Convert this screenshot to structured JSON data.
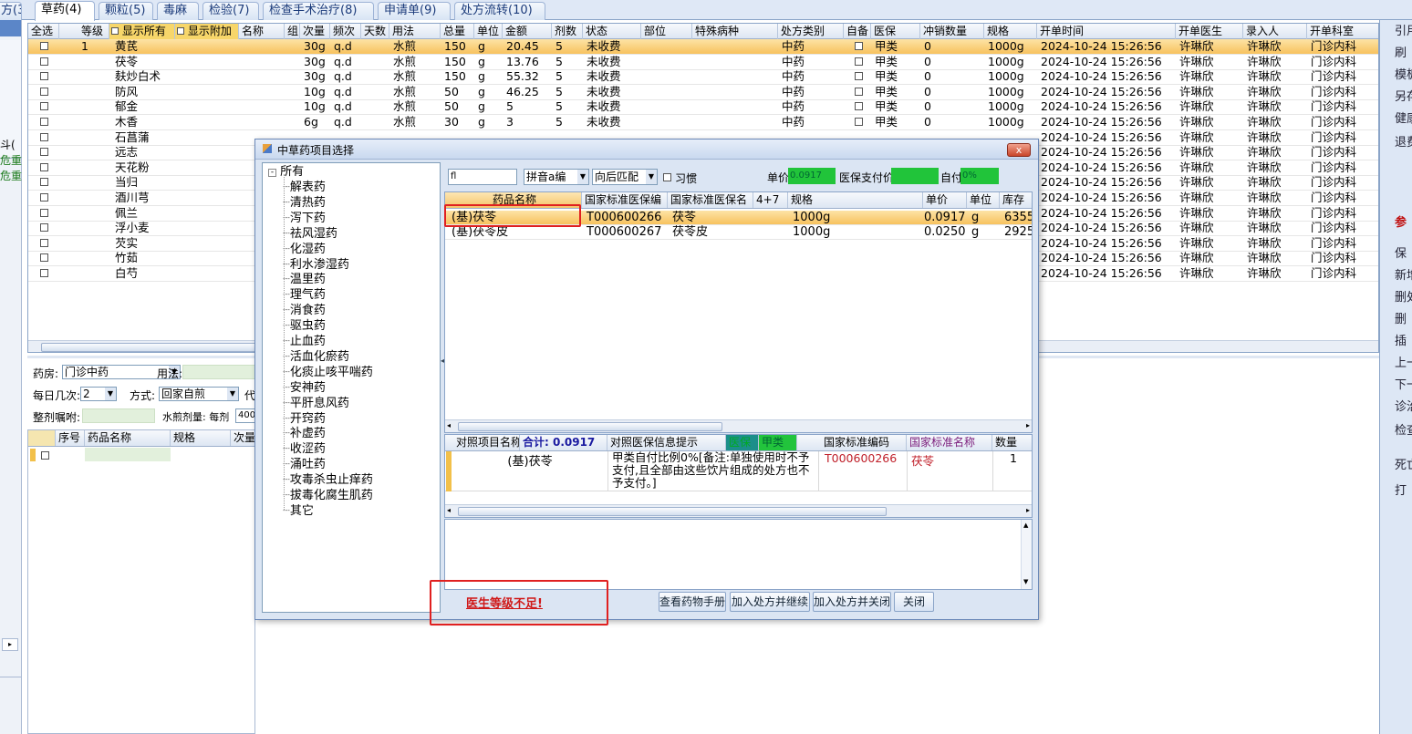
{
  "tabs": [
    "方(3)",
    "草药(4)",
    "颗粒(5)",
    "毒麻",
    "检验(7)",
    "检查手术治疗(8)",
    "申请单(9)",
    "处方流转(10)"
  ],
  "left_strip": {
    "text1": "斗(",
    "text2": "危重",
    "text3": "危重"
  },
  "grid": {
    "headers": [
      "全选",
      "等级",
      "显示所有",
      "显示附加",
      "名称",
      "组",
      "次量",
      "频次",
      "天数",
      "用法",
      "总量",
      "单位",
      "金额",
      "剂数",
      "状态",
      "部位",
      "特殊病种",
      "处方类别",
      "自备",
      "医保",
      "冲销数量",
      "规格",
      "开单时间",
      "开单医生",
      "录入人",
      "开单科室"
    ],
    "rows": [
      {
        "level": "1",
        "name": "黄芪",
        "dose": "30g",
        "freq": "q.d",
        "usage": "水煎",
        "total": "150",
        "unit": "g",
        "amount": "20.45",
        "count": "5",
        "status": "未收费",
        "rxtype": "中药",
        "insurance": "甲类",
        "offset": "0",
        "spec": "1000g",
        "time": "2024-10-24 15:26:56",
        "doctor": "许琳欣",
        "entry": "许琳欣",
        "dept": "门诊内科"
      },
      {
        "level": "",
        "name": "茯苓",
        "dose": "30g",
        "freq": "q.d",
        "usage": "水煎",
        "total": "150",
        "unit": "g",
        "amount": "13.76",
        "count": "5",
        "status": "未收费",
        "rxtype": "中药",
        "insurance": "甲类",
        "offset": "0",
        "spec": "1000g",
        "time": "2024-10-24 15:26:56",
        "doctor": "许琳欣",
        "entry": "许琳欣",
        "dept": "门诊内科"
      },
      {
        "level": "",
        "name": "麸炒白术",
        "dose": "30g",
        "freq": "q.d",
        "usage": "水煎",
        "total": "150",
        "unit": "g",
        "amount": "55.32",
        "count": "5",
        "status": "未收费",
        "rxtype": "中药",
        "insurance": "甲类",
        "offset": "0",
        "spec": "1000g",
        "time": "2024-10-24 15:26:56",
        "doctor": "许琳欣",
        "entry": "许琳欣",
        "dept": "门诊内科"
      },
      {
        "level": "",
        "name": "防风",
        "dose": "10g",
        "freq": "q.d",
        "usage": "水煎",
        "total": "50",
        "unit": "g",
        "amount": "46.25",
        "count": "5",
        "status": "未收费",
        "rxtype": "中药",
        "insurance": "甲类",
        "offset": "0",
        "spec": "1000g",
        "time": "2024-10-24 15:26:56",
        "doctor": "许琳欣",
        "entry": "许琳欣",
        "dept": "门诊内科"
      },
      {
        "level": "",
        "name": "郁金",
        "dose": "10g",
        "freq": "q.d",
        "usage": "水煎",
        "total": "50",
        "unit": "g",
        "amount": "5",
        "count": "5",
        "status": "未收费",
        "rxtype": "中药",
        "insurance": "甲类",
        "offset": "0",
        "spec": "1000g",
        "time": "2024-10-24 15:26:56",
        "doctor": "许琳欣",
        "entry": "许琳欣",
        "dept": "门诊内科"
      },
      {
        "level": "",
        "name": "木香",
        "dose": "6g",
        "freq": "q.d",
        "usage": "水煎",
        "total": "30",
        "unit": "g",
        "amount": "3",
        "count": "5",
        "status": "未收费",
        "rxtype": "中药",
        "insurance": "甲类",
        "offset": "0",
        "spec": "1000g",
        "time": "2024-10-24 15:26:56",
        "doctor": "许琳欣",
        "entry": "许琳欣",
        "dept": "门诊内科"
      },
      {
        "level": "",
        "name": "石菖蒲",
        "dose": "",
        "freq": "",
        "usage": "",
        "total": "",
        "unit": "",
        "amount": "",
        "count": "",
        "status": "",
        "rxtype": "",
        "insurance": "",
        "offset": "",
        "spec": "",
        "time": "2024-10-24 15:26:56",
        "doctor": "许琳欣",
        "entry": "许琳欣",
        "dept": "门诊内科"
      },
      {
        "level": "",
        "name": "远志",
        "dose": "",
        "freq": "",
        "usage": "",
        "total": "",
        "unit": "",
        "amount": "",
        "count": "",
        "status": "",
        "rxtype": "",
        "insurance": "",
        "offset": "",
        "spec": "",
        "time": "2024-10-24 15:26:56",
        "doctor": "许琳欣",
        "entry": "许琳欣",
        "dept": "门诊内科"
      },
      {
        "level": "",
        "name": "天花粉",
        "dose": "",
        "freq": "",
        "usage": "",
        "total": "",
        "unit": "",
        "amount": "",
        "count": "",
        "status": "",
        "rxtype": "",
        "insurance": "",
        "offset": "",
        "spec": "",
        "time": "2024-10-24 15:26:56",
        "doctor": "许琳欣",
        "entry": "许琳欣",
        "dept": "门诊内科"
      },
      {
        "level": "",
        "name": "当归",
        "dose": "",
        "freq": "",
        "usage": "",
        "total": "",
        "unit": "",
        "amount": "",
        "count": "",
        "status": "",
        "rxtype": "",
        "insurance": "",
        "offset": "",
        "spec": "",
        "time": "2024-10-24 15:26:56",
        "doctor": "许琳欣",
        "entry": "许琳欣",
        "dept": "门诊内科"
      },
      {
        "level": "",
        "name": "酒川芎",
        "dose": "",
        "freq": "",
        "usage": "",
        "total": "",
        "unit": "",
        "amount": "",
        "count": "",
        "status": "",
        "rxtype": "",
        "insurance": "",
        "offset": "",
        "spec": "",
        "time": "2024-10-24 15:26:56",
        "doctor": "许琳欣",
        "entry": "许琳欣",
        "dept": "门诊内科"
      },
      {
        "level": "",
        "name": "佩兰",
        "dose": "",
        "freq": "",
        "usage": "",
        "total": "",
        "unit": "",
        "amount": "",
        "count": "",
        "status": "",
        "rxtype": "",
        "insurance": "",
        "offset": "",
        "spec": "",
        "time": "2024-10-24 15:26:56",
        "doctor": "许琳欣",
        "entry": "许琳欣",
        "dept": "门诊内科"
      },
      {
        "level": "",
        "name": "浮小麦",
        "dose": "",
        "freq": "",
        "usage": "",
        "total": "",
        "unit": "",
        "amount": "",
        "count": "",
        "status": "",
        "rxtype": "",
        "insurance": "",
        "offset": "",
        "spec": "",
        "time": "2024-10-24 15:26:56",
        "doctor": "许琳欣",
        "entry": "许琳欣",
        "dept": "门诊内科"
      },
      {
        "level": "",
        "name": "芡实",
        "dose": "",
        "freq": "",
        "usage": "",
        "total": "",
        "unit": "",
        "amount": "",
        "count": "",
        "status": "",
        "rxtype": "",
        "insurance": "",
        "offset": "",
        "spec": "",
        "time": "2024-10-24 15:26:56",
        "doctor": "许琳欣",
        "entry": "许琳欣",
        "dept": "门诊内科"
      },
      {
        "level": "",
        "name": "竹茹",
        "dose": "",
        "freq": "",
        "usage": "",
        "total": "",
        "unit": "",
        "amount": "",
        "count": "",
        "status": "",
        "rxtype": "",
        "insurance": "",
        "offset": "",
        "spec": "",
        "time": "2024-10-24 15:26:56",
        "doctor": "许琳欣",
        "entry": "许琳欣",
        "dept": "门诊内科"
      },
      {
        "level": "",
        "name": "白芍",
        "dose": "",
        "freq": "",
        "usage": "",
        "total": "",
        "unit": "",
        "amount": "",
        "count": "",
        "status": "",
        "rxtype": "",
        "insurance": "",
        "offset": "",
        "spec": "",
        "time": "2024-10-24 15:26:56",
        "doctor": "许琳欣",
        "entry": "许琳欣",
        "dept": "门诊内科"
      }
    ]
  },
  "lower": {
    "pharmacy_label": "药房:",
    "pharmacy_value": "门诊中药",
    "usage_label": "用法:",
    "times_label": "每日几次:",
    "times_value": "2",
    "method_label": "方式:",
    "method_value": "回家自煎",
    "method_suffix": "代",
    "note_label": "整剂嘱咐:",
    "water_label": "水煎剂量: 每剂",
    "water_value": "400",
    "headers": [
      "序号",
      "药品名称",
      "规格",
      "次量"
    ]
  },
  "right_toolbar": [
    "引用",
    "刷",
    "模板",
    "另存",
    "健康",
    "退费",
    "参",
    "保",
    "新增",
    "删处",
    "删",
    "插",
    "上一",
    "下一",
    "诊治",
    "检查认",
    "死亡",
    "打"
  ],
  "dialog": {
    "title": "中草药项目选择",
    "close": "x",
    "tree_root": "所有",
    "tree_items": [
      "解表药",
      "清热药",
      "泻下药",
      "祛风湿药",
      "化湿药",
      "利水渗湿药",
      "温里药",
      "理气药",
      "消食药",
      "驱虫药",
      "止血药",
      "活血化瘀药",
      "化痰止咳平喘药",
      "安神药",
      "平肝息风药",
      "开窍药",
      "补虚药",
      "收涩药",
      "涌吐药",
      "攻毒杀虫止痒药",
      "拔毒化腐生肌药",
      "其它"
    ],
    "search_value": "fl",
    "mode_value": "拼音a编",
    "match_value": "向后匹配",
    "habit_label": "习惯",
    "price_label": "单价",
    "price_value": "0.0917",
    "ins_price_label": "医保支付价",
    "self_pay_label": "自付",
    "self_pay_value": "0%",
    "result_headers": [
      "药品名称",
      "国家标准医保编",
      "国家标准医保名",
      "4+7",
      "规格",
      "单价",
      "单位",
      "库存"
    ],
    "results": [
      {
        "name": "(基)茯苓",
        "code": "T000600266",
        "std_name": "茯苓",
        "spec": "1000g",
        "price": "0.0917",
        "unit": "g",
        "stock": "6355"
      },
      {
        "name": "(基)茯苓皮",
        "code": "T000600267",
        "std_name": "茯苓皮",
        "spec": "1000g",
        "price": "0.0250",
        "unit": "g",
        "stock": "2925"
      }
    ],
    "info_headers": {
      "item": "对照项目名称",
      "total": "合计: 0.0917",
      "tip": "对照医保信息提示",
      "ins": "医保",
      "cls": "甲类",
      "code": "国家标准编码",
      "std": "国家标准名称",
      "qty": "数量"
    },
    "info_row": {
      "item": "(基)茯苓",
      "tip": "甲类自付比例0%[备注:单独使用时不予支付,且全部由这些饮片组成的处方也不予支付。]",
      "code": "T000600266",
      "std": "茯苓",
      "qty": "1"
    },
    "warning": "医生等级不足!",
    "buttons": [
      "查看药物手册",
      "加入处方并继续",
      "加入处方并关闭",
      "关闭"
    ]
  }
}
